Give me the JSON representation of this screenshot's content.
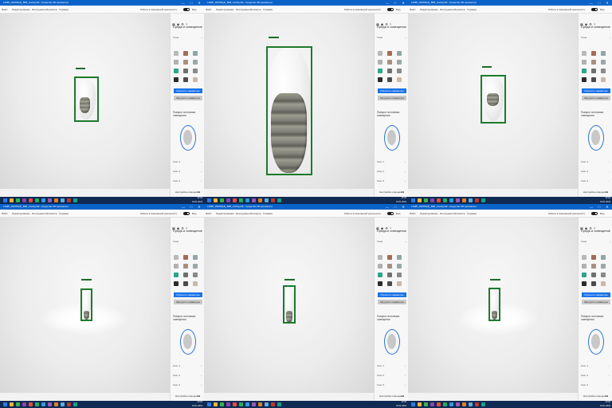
{
  "window": {
    "title": "LAMP_WHITE(4)_BIM_Config.3dl - Средство 3D-просмотра",
    "minimize_label": "—",
    "maximize_label": "□",
    "close_label": "✕"
  },
  "menu": {
    "items": [
      "Файл",
      "Редактирование",
      "Инструменты",
      "Просмотр",
      "Справка"
    ],
    "mixed_reality_label": "Работа в смешанной реальности",
    "mode_label": "Вид"
  },
  "side_panel": {
    "icons": [
      "grid-icon",
      "camera-icon",
      "gear-icon",
      "help-icon"
    ],
    "title": "Среда и освещение",
    "theme_label": "Тема",
    "reset_button_label": "Сбросить параметры",
    "load_button_label": "Загрузить параметры",
    "rotate_label": "Поворот источника освещения",
    "lights": [
      "Свет 1",
      "Свет 2",
      "Свет 3"
    ],
    "footer_label": "Настройки освещения",
    "footer_value": "0.9"
  },
  "swatch_colors": [
    "#b8b8b8",
    "#a46b55",
    "#8fa6a6",
    "#b0b0b0",
    "#a98f7f",
    "#9aa8a8",
    "#2da68a",
    "#707070",
    "#8a8a8a",
    "#2b2b2b",
    "#4b4b4b",
    "#c9b7a9"
  ],
  "accent_color": "#1a73e8",
  "selection_color": "#1c7a2c",
  "taskbar": {
    "icon_colors": [
      "#2c7be5",
      "#f3b43d",
      "#39b54a",
      "#8e44ad",
      "#e74c3c",
      "#27ae60",
      "#3498db",
      "#9b59b6",
      "#e67e22",
      "#5dade2",
      "#c0392b",
      "#16a085"
    ],
    "time": "12:34",
    "date": "01.01.2024"
  },
  "panels": [
    {
      "name": "view-1"
    },
    {
      "name": "view-2"
    },
    {
      "name": "view-3"
    },
    {
      "name": "view-4"
    },
    {
      "name": "view-5"
    },
    {
      "name": "view-6"
    }
  ]
}
